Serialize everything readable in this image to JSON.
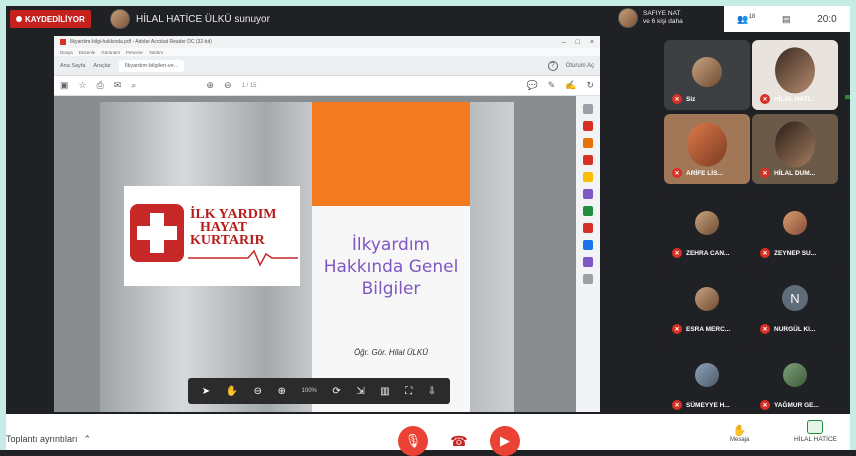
{
  "meet": {
    "recording_label": "KAYDEDİLİYOR",
    "presenter_text": "HİLAL HATİCE ÜLKÜ sunuyor",
    "joined_name": "SAFIYE NAT",
    "joined_text": "ve 6 kişi daha",
    "participants_count": "18",
    "time": "20:0"
  },
  "browser": {
    "window_title": "İlkyardım-bilgi-hakkında.pdf - Adobe Acrobat Reader DC (32-bit)",
    "menu_items": [
      "Dosya",
      "Düzenle",
      "Görünüm",
      "Pencere",
      "Yardım"
    ],
    "tabs": [
      "Ana Sayfa",
      "Araçlar",
      "İlkyardım-bilgileri-ve..."
    ],
    "signin_label": "Oturum Aç",
    "page_indicator": "1 / 15",
    "zoom_level": "100%"
  },
  "slide": {
    "logo_line1": "İLK YARDIM",
    "logo_line2": "HAYAT",
    "logo_line3": "KURTARIR",
    "title": "İlkyardım Hakkında Genel Bilgiler",
    "author": "Öğr. Gör. Hilal ÜLKÜ"
  },
  "participants": [
    {
      "name": "Siz"
    },
    {
      "name": "HİLAL HATİ..."
    },
    {
      "name": "ARİFE LİS..."
    },
    {
      "name": "HİLAL DUM..."
    },
    {
      "name": "ZEHRA CAN..."
    },
    {
      "name": "ZEYNEP SU..."
    },
    {
      "name": "ESRA MERC..."
    },
    {
      "name": "NURGÜL KI..."
    },
    {
      "name": "SÜMEYYE H..."
    },
    {
      "name": "YAĞMUR GE..."
    }
  ],
  "bottom": {
    "details_label": "Toplantı ayrıntıları",
    "raise_label": "Mesaja",
    "presenting_label": "HİLAL HATİCE"
  },
  "colors": {
    "record_red": "#c5221f",
    "slide_orange": "#f47a20",
    "title_purple": "#7e57c2",
    "frame": "#c7ece6"
  }
}
